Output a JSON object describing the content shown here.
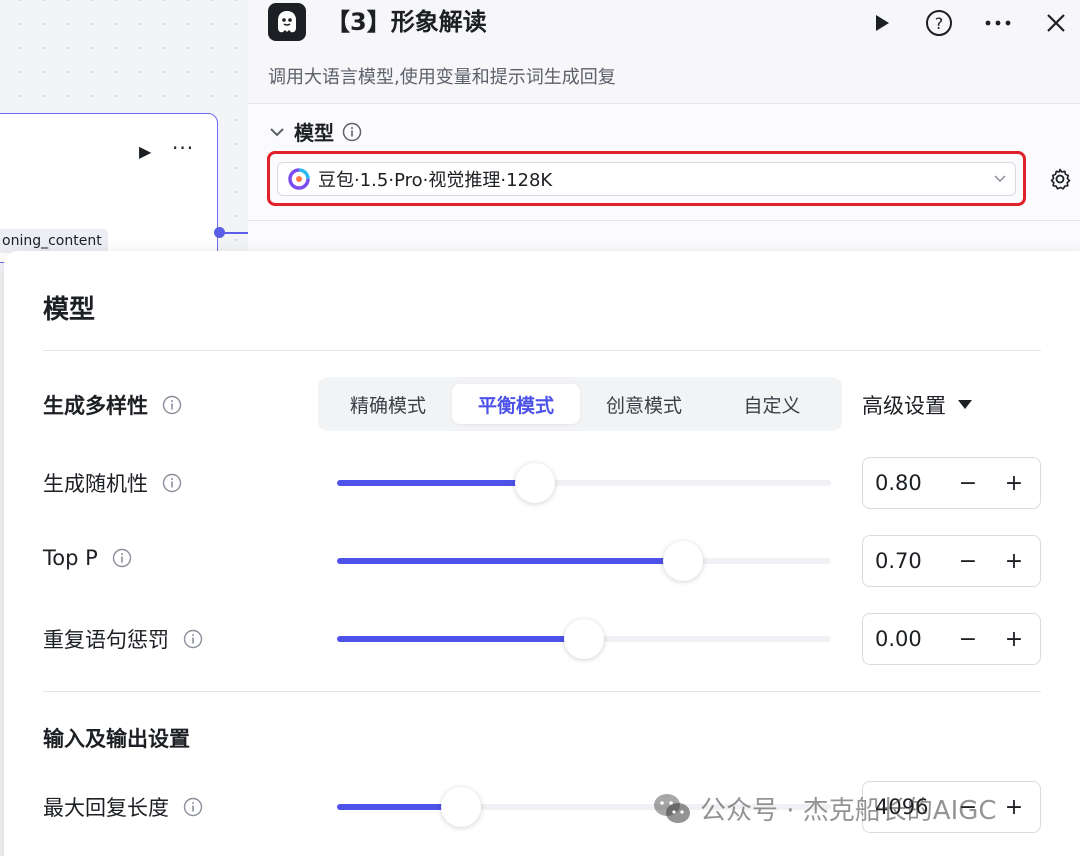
{
  "canvas": {
    "node_tag": "oning_content"
  },
  "panel": {
    "title": "【3】形象解读",
    "description": "调用大语言模型,使用变量和提示词生成回复",
    "section_label": "模型",
    "model_name": "豆包·1.5·Pro·视觉推理·128K"
  },
  "popover": {
    "title": "模型",
    "diversity_label": "生成多样性",
    "modes": [
      "精确模式",
      "平衡模式",
      "创意模式",
      "自定义"
    ],
    "active_mode": "平衡模式",
    "advanced_label": "高级设置",
    "params": [
      {
        "label": "生成随机性",
        "value": "0.80",
        "fill": 0.4
      },
      {
        "label": "Top P",
        "value": "0.70",
        "fill": 0.7
      },
      {
        "label": "重复语句惩罚",
        "value": "0.00",
        "fill": 0.5
      }
    ],
    "io_section": "输入及输出设置",
    "max_len": {
      "label": "最大回复长度",
      "value": "4096",
      "fill": 0.25
    },
    "minus": "−",
    "plus": "+"
  },
  "watermark": "公众号 · 杰克船长的AIGC",
  "colors": {
    "accent": "#4d53e8",
    "highlight": "#e0202a"
  }
}
